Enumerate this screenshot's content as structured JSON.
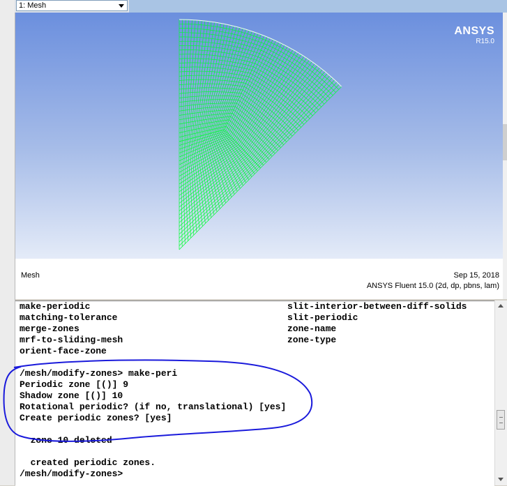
{
  "viewer": {
    "display_select": "1: Mesh",
    "logo_brand": "ANSYS",
    "logo_version": "R15.0",
    "footer_title": "Mesh",
    "footer_date": "Sep 15, 2018",
    "footer_product": "ANSYS Fluent 15.0 (2d, dp, pbns, lam)",
    "mesh_color": "#00ff33"
  },
  "console": {
    "lines": [
      "make-periodic",
      "matching-tolerance",
      "merge-zones",
      "mrf-to-sliding-mesh",
      "orient-face-zone",
      "",
      "/mesh/modify-zones> make-peri",
      "Periodic zone [()] 9",
      "Shadow zone [()] 10",
      "Rotational periodic? (if no, translational) [yes]",
      "Create periodic zones? [yes]",
      "",
      "  zone 10 deleted",
      "",
      "  created periodic zones.",
      "/mesh/modify-zones>"
    ],
    "right_column": [
      "slit-interior-between-diff-solids",
      "slit-periodic",
      "zone-name",
      "zone-type"
    ]
  },
  "annotation_color": "#1a1adb"
}
